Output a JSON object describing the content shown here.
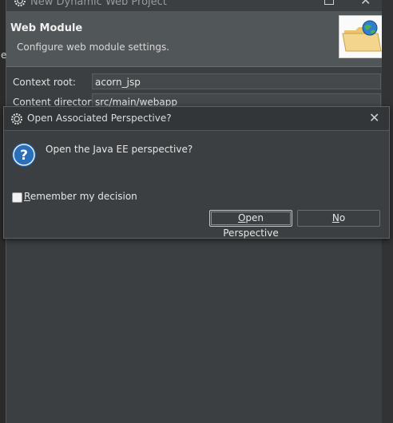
{
  "background_window": {
    "title": "New Dynamic Web Project",
    "banner": {
      "title": "Web Module",
      "description": "Configure web module settings."
    },
    "left_edge_char": "e",
    "fields": [
      {
        "label": "Context root:",
        "value": "acorn_jsp"
      },
      {
        "label": "Content directory:",
        "value": "src/main/webapp"
      }
    ],
    "icons": {
      "app": "eclipse-icon",
      "banner": "folder-globe-icon",
      "maximize": "maximize-icon",
      "close": "close-icon"
    }
  },
  "dialog": {
    "title": "Open Associated Perspective?",
    "message": "Open the Java EE perspective?",
    "checkbox": {
      "label_mnemonic": "R",
      "label_rest": "emember my decision",
      "checked": false
    },
    "buttons": {
      "primary": {
        "mnemonic": "O",
        "rest": "pen Perspective"
      },
      "secondary": {
        "mnemonic": "N",
        "rest": "o"
      }
    },
    "icons": {
      "title": "eclipse-icon",
      "message": "question-icon",
      "close": "close-icon"
    }
  },
  "colors": {
    "background": "#3c3f41",
    "banner": "#515658",
    "question_icon": "#2a6fb8"
  }
}
